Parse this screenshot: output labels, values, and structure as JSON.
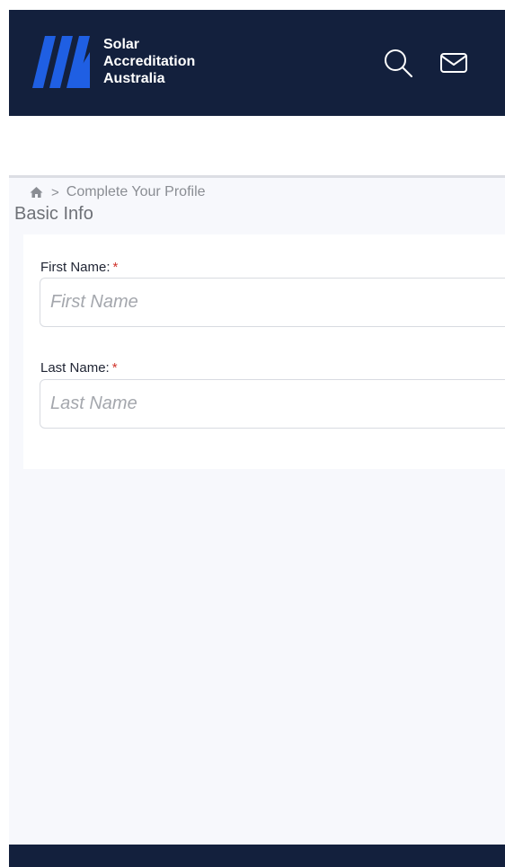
{
  "header": {
    "brand_line1": "Solar",
    "brand_line2": "Accreditation",
    "brand_line3": "Australia",
    "logo_color": "#1f5fe3",
    "background": "#13203d",
    "icons": [
      "search-icon",
      "mail-icon"
    ]
  },
  "breadcrumb": {
    "home_icon": "home-icon",
    "separator": ">",
    "current": "Complete Your Profile"
  },
  "section": {
    "title": "Basic Info"
  },
  "form": {
    "first_name": {
      "label": "First Name:",
      "required_mark": "*",
      "placeholder": "First Name",
      "value": ""
    },
    "last_name": {
      "label": "Last Name:",
      "required_mark": "*",
      "placeholder": "Last Name",
      "value": ""
    }
  }
}
